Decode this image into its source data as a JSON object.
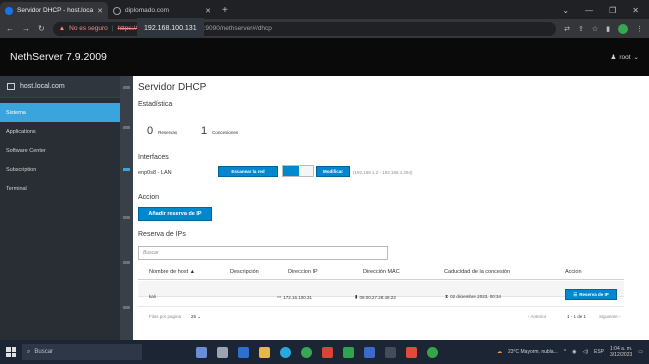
{
  "browser": {
    "tabs": [
      {
        "title": "Servidor DHCP - host.local.com",
        "active": true
      },
      {
        "title": "diplomado.com",
        "active": false
      }
    ],
    "new_tab": "+",
    "address": {
      "warning": "No es seguro",
      "scheme": "https://",
      "host": "192.168.100.131",
      "path": ":9090/nethserver#/dhcp"
    }
  },
  "app": {
    "brand": "NethServer 7.9.2009",
    "user": "root"
  },
  "sidebar": {
    "host": "host.local.com",
    "items": [
      {
        "label": "Sistema",
        "active": true
      },
      {
        "label": "Applications",
        "active": false
      },
      {
        "label": "Software Center",
        "active": false
      },
      {
        "label": "Subscription",
        "active": false
      },
      {
        "label": "Terminal",
        "active": false
      }
    ]
  },
  "content": {
    "title": "Servidor DHCP",
    "stats_heading": "Estadística",
    "stats": [
      {
        "value": "0",
        "label": "Reservas"
      },
      {
        "value": "1",
        "label": "Concesiones"
      }
    ],
    "interfaces_heading": "Interfaces",
    "interface": {
      "name": "enp0s8 - LAN",
      "scan_button": "Escanear la red",
      "modify_button": "Modificar",
      "range": "(192.168.1.2 - 192.168.1.254)"
    },
    "action_heading": "Accion",
    "add_button": "Añadir reserva de IP",
    "reservations_heading": "Reserva de IPs",
    "search_placeholder": "Buscar",
    "columns": [
      "Nombre de host ▲",
      "Descripción",
      "Direccion IP",
      "Dirección MAC",
      "Caducidad de la concesión",
      "Accion"
    ],
    "row": {
      "host": "kali",
      "description": "",
      "ip": "172.16.100.31",
      "mac": "08:00:27:28:49:23",
      "expiry": "02 diciembre 2023, 00:34",
      "action": "Reserva de IP"
    },
    "footer": {
      "rows_label": "Filas por pagina",
      "rows_value": "25",
      "prev": "Anterior",
      "range": "1 - 1 de 1",
      "next": "Siguiente"
    }
  },
  "taskbar": {
    "search": "Buscar",
    "weather": "23°C  Mayorm. nubla...",
    "lang": "ESP",
    "time": "1:04 a. m.",
    "date": "3/12/2023"
  },
  "colors": {
    "accent": "#0088ce",
    "nav_active": "#39a5dc",
    "sidebar": "#292e34"
  }
}
